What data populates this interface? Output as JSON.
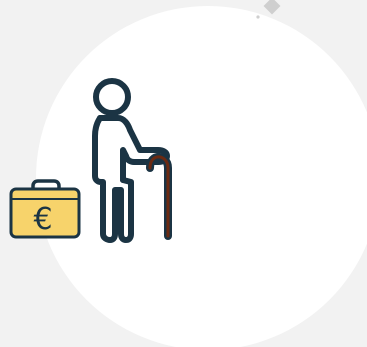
{
  "illustration": {
    "colors": {
      "background": "#f2f2f2",
      "circle": "#ffffff",
      "outline": "#1b3444",
      "cane": "#6b2a12",
      "briefcase": "#f7d36b",
      "diamond": "#cfcfcf"
    },
    "icons": {
      "elderly_person": "elderly-person-icon",
      "walking_cane": "walking-cane-icon",
      "briefcase": "euro-briefcase-icon",
      "decor": "diamond-icon"
    },
    "briefcase_symbol": "€"
  }
}
